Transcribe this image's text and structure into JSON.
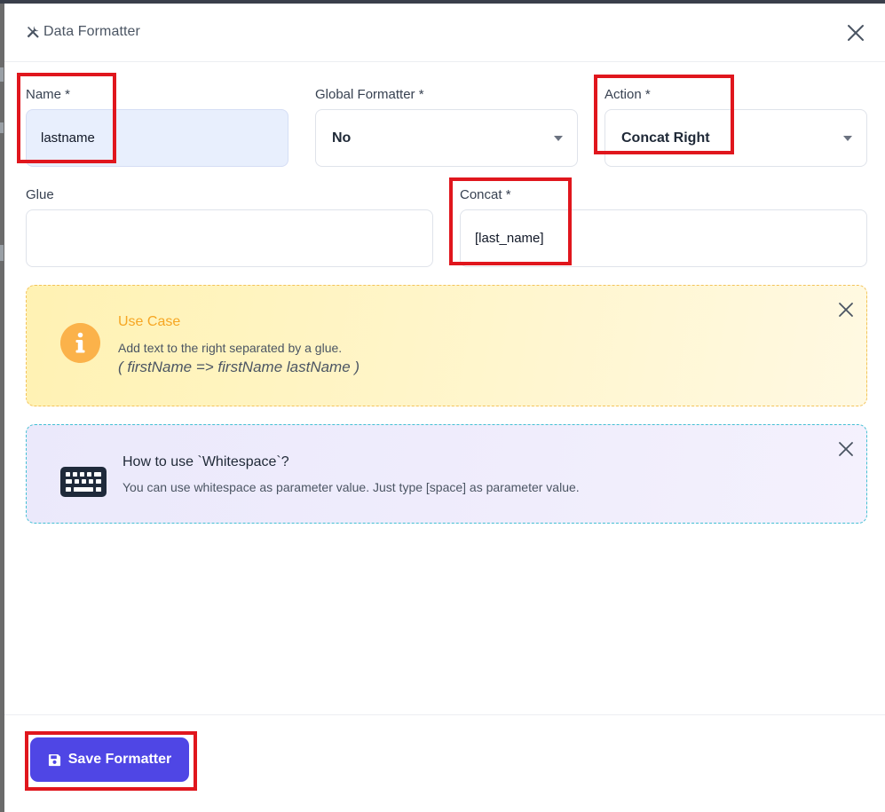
{
  "dialog": {
    "title": "Data Formatter",
    "icon": "tools-icon"
  },
  "form": {
    "name": {
      "label": "Name *",
      "value": "lastname"
    },
    "global_formatter": {
      "label": "Global Formatter *",
      "value": "No"
    },
    "action": {
      "label": "Action *",
      "value": "Concat Right"
    },
    "glue": {
      "label": "Glue",
      "value": ""
    },
    "concat": {
      "label": "Concat *",
      "value": "[last_name]"
    }
  },
  "alerts": {
    "use_case": {
      "title": "Use Case",
      "description": "Add text to the right separated by a glue.",
      "example": "( firstName => firstName lastName )",
      "icon": "info-icon",
      "color": "#f6a623"
    },
    "whitespace": {
      "title": "How to use `Whitespace`?",
      "description": "You can use whitespace as parameter value. Just type [space] as parameter value.",
      "icon": "keyboard-icon"
    }
  },
  "footer": {
    "save_label": "Save Formatter",
    "save_icon": "floppy-disk-icon",
    "accent": "#4f46e5"
  },
  "highlight_color": "#e0161d"
}
